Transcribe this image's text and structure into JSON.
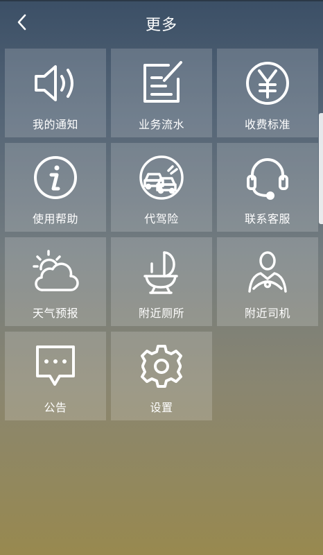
{
  "header": {
    "title": "更多",
    "back_icon": "chevron-left-icon"
  },
  "tiles": [
    {
      "label": "我的通知",
      "icon": "speaker-icon"
    },
    {
      "label": "业务流水",
      "icon": "notepad-icon"
    },
    {
      "label": "收费标准",
      "icon": "yen-icon"
    },
    {
      "label": "使用帮助",
      "icon": "info-icon"
    },
    {
      "label": "代驾险",
      "icon": "car-insurance-icon"
    },
    {
      "label": "联系客服",
      "icon": "headset-icon"
    },
    {
      "label": "天气预报",
      "icon": "weather-icon"
    },
    {
      "label": "附近厕所",
      "icon": "toilet-icon"
    },
    {
      "label": "附近司机",
      "icon": "driver-icon"
    },
    {
      "label": "公告",
      "icon": "announcement-icon"
    },
    {
      "label": "设置",
      "icon": "gear-icon"
    }
  ],
  "colors": {
    "tile_bg": "rgba(255,255,255,0.17)",
    "text": "#ffffff"
  }
}
